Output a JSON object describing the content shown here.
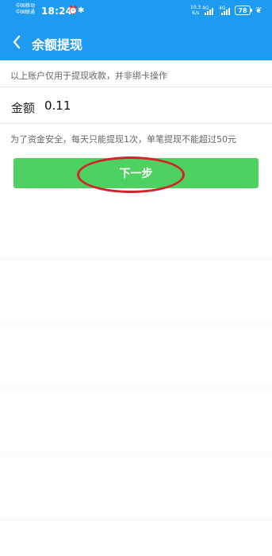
{
  "status_bar": {
    "carrier_1": "中国移动",
    "carrier_2": "中国联通",
    "time": "18:24",
    "speed_top": "10.3",
    "speed_bottom": "K/s",
    "net_1": "4G",
    "net_2": "4G",
    "battery": "78",
    "accent_color": "#1e9bf0"
  },
  "header": {
    "title": "余额提现",
    "back_icon": "chevron-left-icon"
  },
  "info": {
    "text": "以上账户仅用于提现收款，并非绑卡操作"
  },
  "amount": {
    "label": "金额",
    "value": "0.11"
  },
  "notice": {
    "text": "为了资金安全，每天只能提现1次，单笔提现不能超过50元"
  },
  "next_button": {
    "label": "下一步",
    "color": "#4ed160"
  },
  "annotation": {
    "color": "#d2232a"
  }
}
